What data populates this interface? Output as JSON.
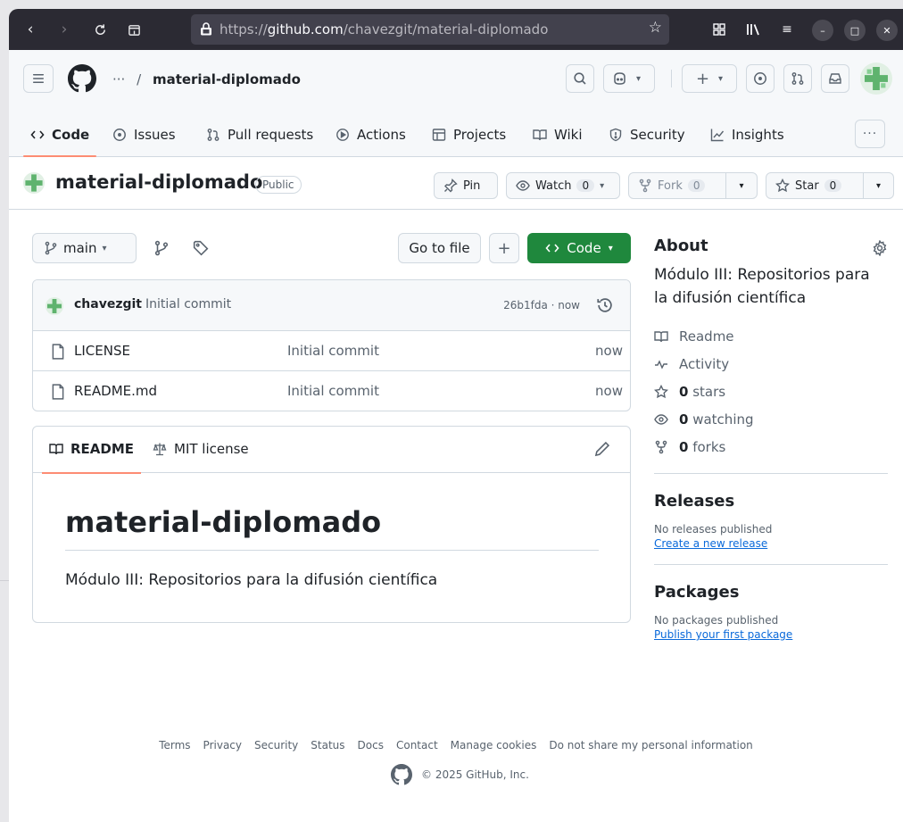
{
  "browser": {
    "url_prefix": "https://",
    "url_host": "github.com",
    "url_path": "/chavezgit/material-diplomado"
  },
  "header": {
    "ellipsis": "···",
    "separator": "/",
    "repo": "material-diplomado"
  },
  "tabs": [
    {
      "label": "Code"
    },
    {
      "label": "Issues"
    },
    {
      "label": "Pull requests"
    },
    {
      "label": "Actions"
    },
    {
      "label": "Projects"
    },
    {
      "label": "Wiki"
    },
    {
      "label": "Security"
    },
    {
      "label": "Insights"
    }
  ],
  "repo": {
    "name": "material-diplomado",
    "visibility": "Public",
    "pin_label": "Pin",
    "watch_label": "Watch",
    "watch_count": "0",
    "fork_label": "Fork",
    "fork_count": "0",
    "star_label": "Star",
    "star_count": "0"
  },
  "files": {
    "branch": "main",
    "goto_label": "Go to file",
    "plus_label": "+",
    "code_label": "Code",
    "commit_author": "chavezgit",
    "commit_message": "Initial commit",
    "commit_meta": "26b1fda · now",
    "rows": [
      {
        "name": "LICENSE",
        "message": "Initial commit",
        "when": "now"
      },
      {
        "name": "README.md",
        "message": "Initial commit",
        "when": "now"
      }
    ]
  },
  "readme": {
    "tab_readme": "README",
    "tab_license": "MIT license",
    "heading": "material-diplomado",
    "body": "Módulo III: Repositorios para la difusión científica"
  },
  "sidebar": {
    "about_title": "About",
    "description": "Módulo III: Repositorios para la difusión científica",
    "readme": "Readme",
    "activity": "Activity",
    "stars_count": "0",
    "stars_label": "stars",
    "watching_count": "0",
    "watching_label": "watching",
    "forks_count": "0",
    "forks_label": "forks",
    "releases_title": "Releases",
    "releases_none": "No releases published",
    "releases_link": "Create a new release",
    "packages_title": "Packages",
    "packages_none": "No packages published",
    "packages_link": "Publish your first package"
  },
  "footer": {
    "links": [
      "Terms",
      "Privacy",
      "Security",
      "Status",
      "Docs",
      "Contact",
      "Manage cookies",
      "Do not share my personal information"
    ],
    "copyright": "© 2025 GitHub, Inc."
  },
  "colors": {
    "accent_green": "#1f883d",
    "tab_underline": "#fd8c73",
    "link_blue": "#0969da",
    "browser_chrome": "#2b2a33"
  }
}
